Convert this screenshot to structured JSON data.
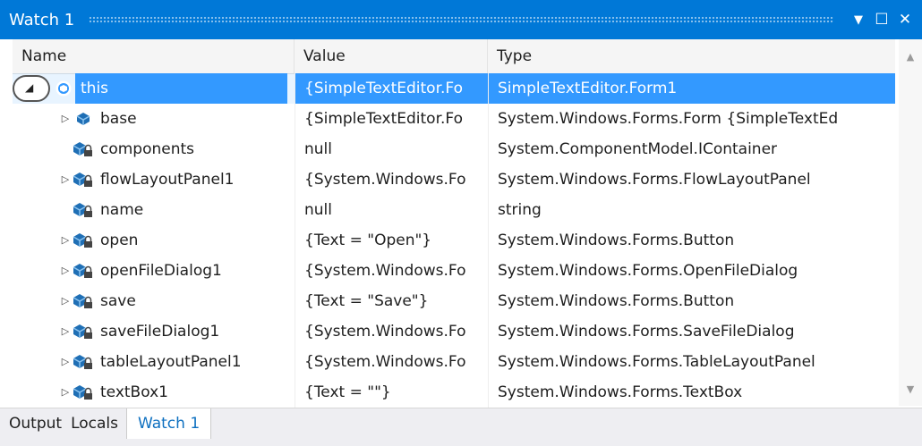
{
  "window": {
    "title": "Watch 1"
  },
  "title_buttons": {
    "dropdown": "▼",
    "maximize": "☐",
    "close": "✕"
  },
  "columns": {
    "name": "Name",
    "value": "Value",
    "type": "Type"
  },
  "rows": [
    {
      "name": "this",
      "value": "{SimpleTextEditor.Fo",
      "type": "SimpleTextEditor.Form1",
      "expander": "◢",
      "icon": "object-icon",
      "selected": true
    },
    {
      "name": "base",
      "value": "{SimpleTextEditor.Fo",
      "type": "System.Windows.Forms.Form {SimpleTextEd",
      "expander": "▷",
      "icon": "class-icon",
      "selected": false
    },
    {
      "name": "components",
      "value": "null",
      "type": "System.ComponentModel.IContainer",
      "expander": "",
      "icon": "private-field-icon",
      "selected": false
    },
    {
      "name": "flowLayoutPanel1",
      "value": "{System.Windows.Fo",
      "type": "System.Windows.Forms.FlowLayoutPanel",
      "expander": "▷",
      "icon": "private-field-icon",
      "selected": false
    },
    {
      "name": "name",
      "value": "null",
      "type": "string",
      "expander": "",
      "icon": "private-field-icon",
      "selected": false
    },
    {
      "name": "open",
      "value": "{Text = \"Open\"}",
      "type": "System.Windows.Forms.Button",
      "expander": "▷",
      "icon": "private-field-icon",
      "selected": false
    },
    {
      "name": "openFileDialog1",
      "value": "{System.Windows.Fo",
      "type": "System.Windows.Forms.OpenFileDialog",
      "expander": "▷",
      "icon": "private-field-icon",
      "selected": false
    },
    {
      "name": "save",
      "value": "{Text = \"Save\"}",
      "type": "System.Windows.Forms.Button",
      "expander": "▷",
      "icon": "private-field-icon",
      "selected": false
    },
    {
      "name": "saveFileDialog1",
      "value": "{System.Windows.Fo",
      "type": "System.Windows.Forms.SaveFileDialog",
      "expander": "▷",
      "icon": "private-field-icon",
      "selected": false
    },
    {
      "name": "tableLayoutPanel1",
      "value": "{System.Windows.Fo",
      "type": "System.Windows.Forms.TableLayoutPanel",
      "expander": "▷",
      "icon": "private-field-icon",
      "selected": false
    },
    {
      "name": "textBox1",
      "value": "{Text = \"\"}",
      "type": "System.Windows.Forms.TextBox",
      "expander": "▷",
      "icon": "private-field-icon",
      "selected": false
    }
  ],
  "tabs": [
    {
      "label": "Output",
      "active": false
    },
    {
      "label": "Locals",
      "active": false
    },
    {
      "label": "Watch 1",
      "active": true
    }
  ],
  "colors": {
    "titlebar": "#0078d7",
    "selection": "#3399ff",
    "active_tab_text": "#0e70c0"
  }
}
